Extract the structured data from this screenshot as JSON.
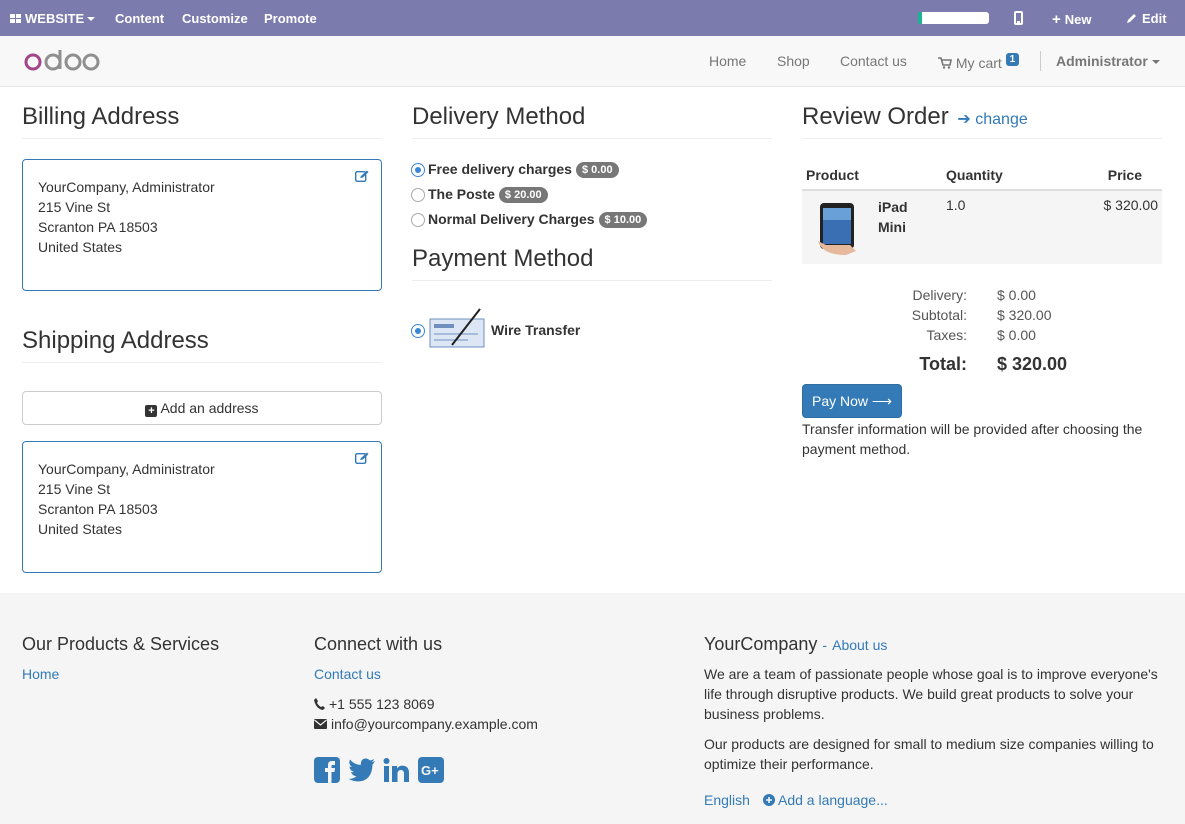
{
  "adminbar": {
    "website": "WEBSITE",
    "content": "Content",
    "customize": "Customize",
    "promote": "Promote",
    "progress": 0.06,
    "new": "New",
    "edit": "Edit"
  },
  "navbar": {
    "logo": "odoo",
    "home": "Home",
    "shop": "Shop",
    "contact": "Contact us",
    "cart": "My cart",
    "cart_count": "1",
    "user": "Administrator"
  },
  "billing": {
    "title": "Billing Address",
    "lines": [
      "YourCompany, Administrator",
      "215 Vine St",
      "Scranton PA 18503",
      "United States"
    ]
  },
  "shipping": {
    "title": "Shipping Address",
    "add_label": "Add an address",
    "lines": [
      "YourCompany, Administrator",
      "215 Vine St",
      "Scranton PA 18503",
      "United States"
    ]
  },
  "delivery": {
    "title": "Delivery Method",
    "options": [
      {
        "label": "Free delivery charges",
        "price": "$ 0.00",
        "selected": true
      },
      {
        "label": "The Poste",
        "price": "$ 20.00",
        "selected": false
      },
      {
        "label": "Normal Delivery Charges",
        "price": "$ 10.00",
        "selected": false
      }
    ]
  },
  "payment": {
    "title": "Payment Method",
    "option": "Wire Transfer"
  },
  "review": {
    "title": "Review Order",
    "change": "change",
    "headers": {
      "product": "Product",
      "quantity": "Quantity",
      "price": "Price"
    },
    "item": {
      "name": "iPad Mini",
      "quantity": "1.0",
      "price": "$ 320.00"
    },
    "delivery_label": "Delivery:",
    "delivery_value": "$ 0.00",
    "subtotal_label": "Subtotal:",
    "subtotal_value": "$ 320.00",
    "taxes_label": "Taxes:",
    "taxes_value": "$ 0.00",
    "total_label": "Total:",
    "total_value": "$ 320.00",
    "pay_button": "Pay Now",
    "note": "Transfer information will be provided after choosing the payment method."
  },
  "footer": {
    "products_title": "Our Products & Services",
    "products_home": "Home",
    "connect_title": "Connect with us",
    "contact": "Contact us",
    "phone": "+1 555 123 8069",
    "email": "info@yourcompany.example.com",
    "company": "YourCompany",
    "about": "About us",
    "about_sep": "-",
    "text1": "We are a team of passionate people whose goal is to improve everyone's life through disruptive products. We build great products to solve your business problems.",
    "text2": "Our products are designed for small to medium size companies willing to optimize their performance.",
    "language": "English",
    "add_language": "Add a language..."
  },
  "colors": {
    "adminbar": "#7c7bad",
    "primary": "#337ab7",
    "footer_bg": "#f5f5f5"
  }
}
